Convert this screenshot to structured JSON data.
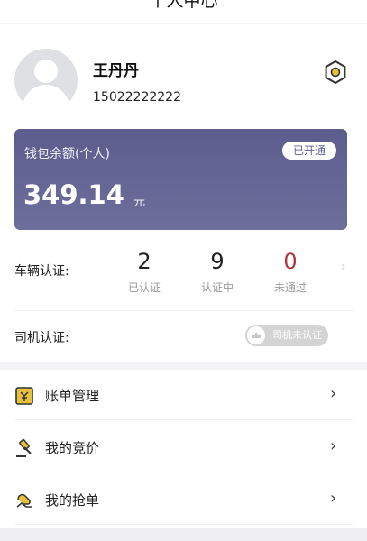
{
  "header": {
    "title": "个人中心"
  },
  "user": {
    "name": "王丹丹",
    "phone": "15022222222"
  },
  "wallet": {
    "label": "钱包余额(个人)",
    "badge": "已开通",
    "amount": "349.14",
    "unit": "元"
  },
  "vehicle": {
    "label": "车辆认证:",
    "stats": [
      {
        "value": "2",
        "caption": "已认证"
      },
      {
        "value": "9",
        "caption": "认证中"
      },
      {
        "value": "0",
        "caption": "未通过"
      }
    ],
    "chevron": "›"
  },
  "driver": {
    "label": "司机认证:",
    "badge": "司机未认证"
  },
  "menu": [
    {
      "label": "账单管理",
      "icon": "bill-icon",
      "chevron": "›"
    },
    {
      "label": "我的竞价",
      "icon": "gavel-icon",
      "chevron": "›"
    },
    {
      "label": "我的抢单",
      "icon": "grab-hand-icon",
      "chevron": "›"
    }
  ],
  "colors": {
    "wallet_bg": "#5c5d8d",
    "accent_yellow": "#e8c13a",
    "rejected_red": "#b0343a"
  }
}
